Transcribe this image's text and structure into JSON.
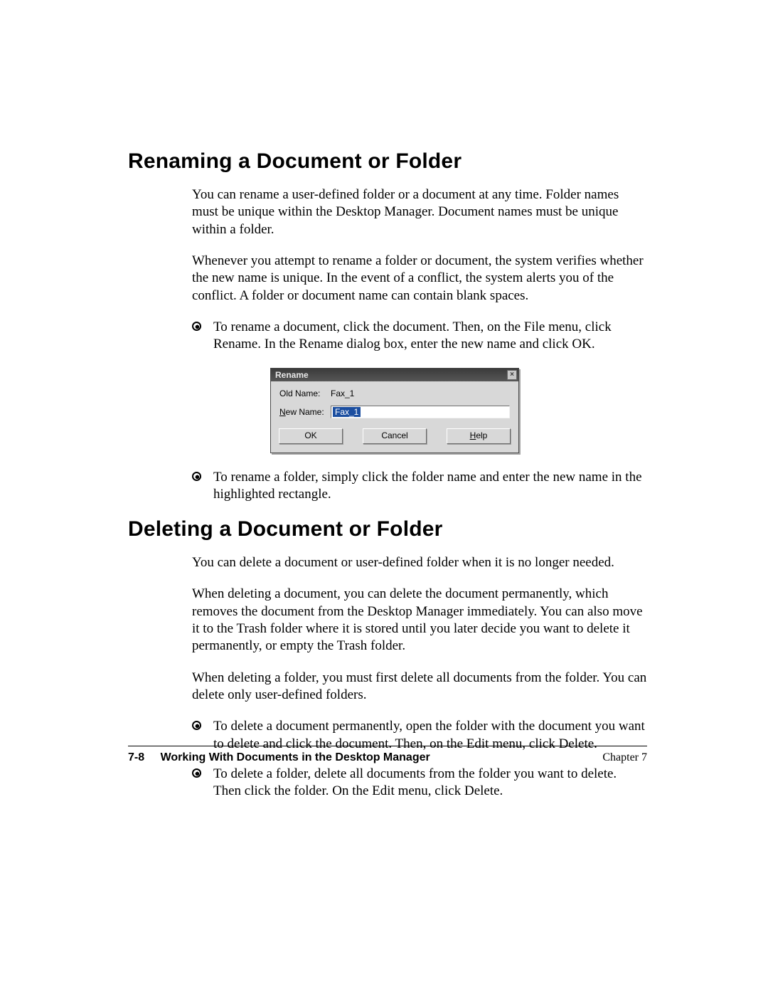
{
  "section1": {
    "heading": "Renaming a Document or Folder",
    "para1": "You can rename a user-defined folder or a document at any time. Folder names must be unique within the Desktop Manager. Document names must be unique within a folder.",
    "para2": "Whenever you attempt to rename a folder or document, the system verifies whether the new name is unique. In the event of a conflict, the system alerts you of the conflict. A folder or document name can contain blank spaces.",
    "bullet1": "To rename a document, click the document. Then, on the File menu, click Rename. In the Rename dialog box, enter the new name and click OK.",
    "bullet2": "To rename a folder, simply click the folder name and enter the new name in the highlighted rectangle."
  },
  "dialog": {
    "title": "Rename",
    "close": "×",
    "old_label": "Old Name:",
    "old_value": "Fax_1",
    "new_label_prefix": "N",
    "new_label_rest": "ew Name:",
    "new_value": "Fax_1",
    "ok": "OK",
    "cancel": "Cancel",
    "help_prefix": "H",
    "help_rest": "elp"
  },
  "section2": {
    "heading": "Deleting a Document or Folder",
    "para1": "You can delete a document or user-defined folder when it is no longer needed.",
    "para2": "When deleting a document, you can delete the document permanently, which removes the document from the Desktop Manager immediately. You can also move it to the Trash folder where it is stored until you later decide you want to delete it permanently, or empty the Trash folder.",
    "para3": "When deleting a folder, you must first delete all documents from the folder. You can delete only user-defined folders.",
    "bullet1": "To delete a document permanently, open the folder with the document you want to delete and click the document. Then, on the Edit menu, click Delete.",
    "bullet2": "To delete a folder, delete all documents from the folder you want to delete. Then click the folder. On the Edit menu, click Delete."
  },
  "footer": {
    "page": "7-8",
    "title": "Working With Documents in the Desktop Manager",
    "chapter": "Chapter 7"
  }
}
